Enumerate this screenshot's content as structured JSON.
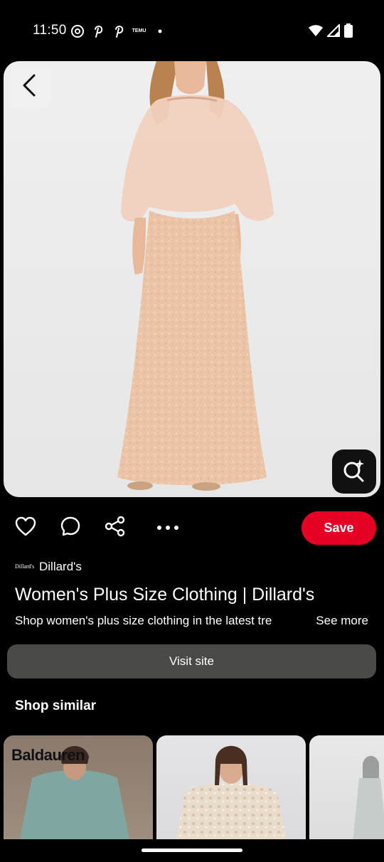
{
  "status_bar": {
    "time": "11:50",
    "left_icons": [
      "threads-icon",
      "pinterest-icon",
      "pinterest-icon",
      "temu-icon",
      "dot-icon"
    ],
    "temu_label": "TEMU",
    "right_icons": [
      "wifi-icon",
      "signal-icon",
      "battery-icon"
    ]
  },
  "pin": {
    "back_icon": "chevron-left-icon",
    "visual_search_icon": "visual-search-icon"
  },
  "actions": {
    "like_icon": "heart-icon",
    "comment_icon": "comment-icon",
    "share_icon": "share-icon",
    "more_icon": "more-icon",
    "save_label": "Save",
    "save_color": "#e60023"
  },
  "source": {
    "logo_text": "Dillard's",
    "name": "Dillard's"
  },
  "title": "Women's Plus Size Clothing | Dillard's",
  "description": "Shop women's plus size clothing in the latest tre",
  "see_more": "See more",
  "visit_site": "Visit site",
  "shop_similar": {
    "heading": "Shop similar",
    "cards": [
      {
        "brand": "Baldauren"
      },
      {
        "brand": ""
      },
      {
        "brand": ""
      }
    ]
  }
}
